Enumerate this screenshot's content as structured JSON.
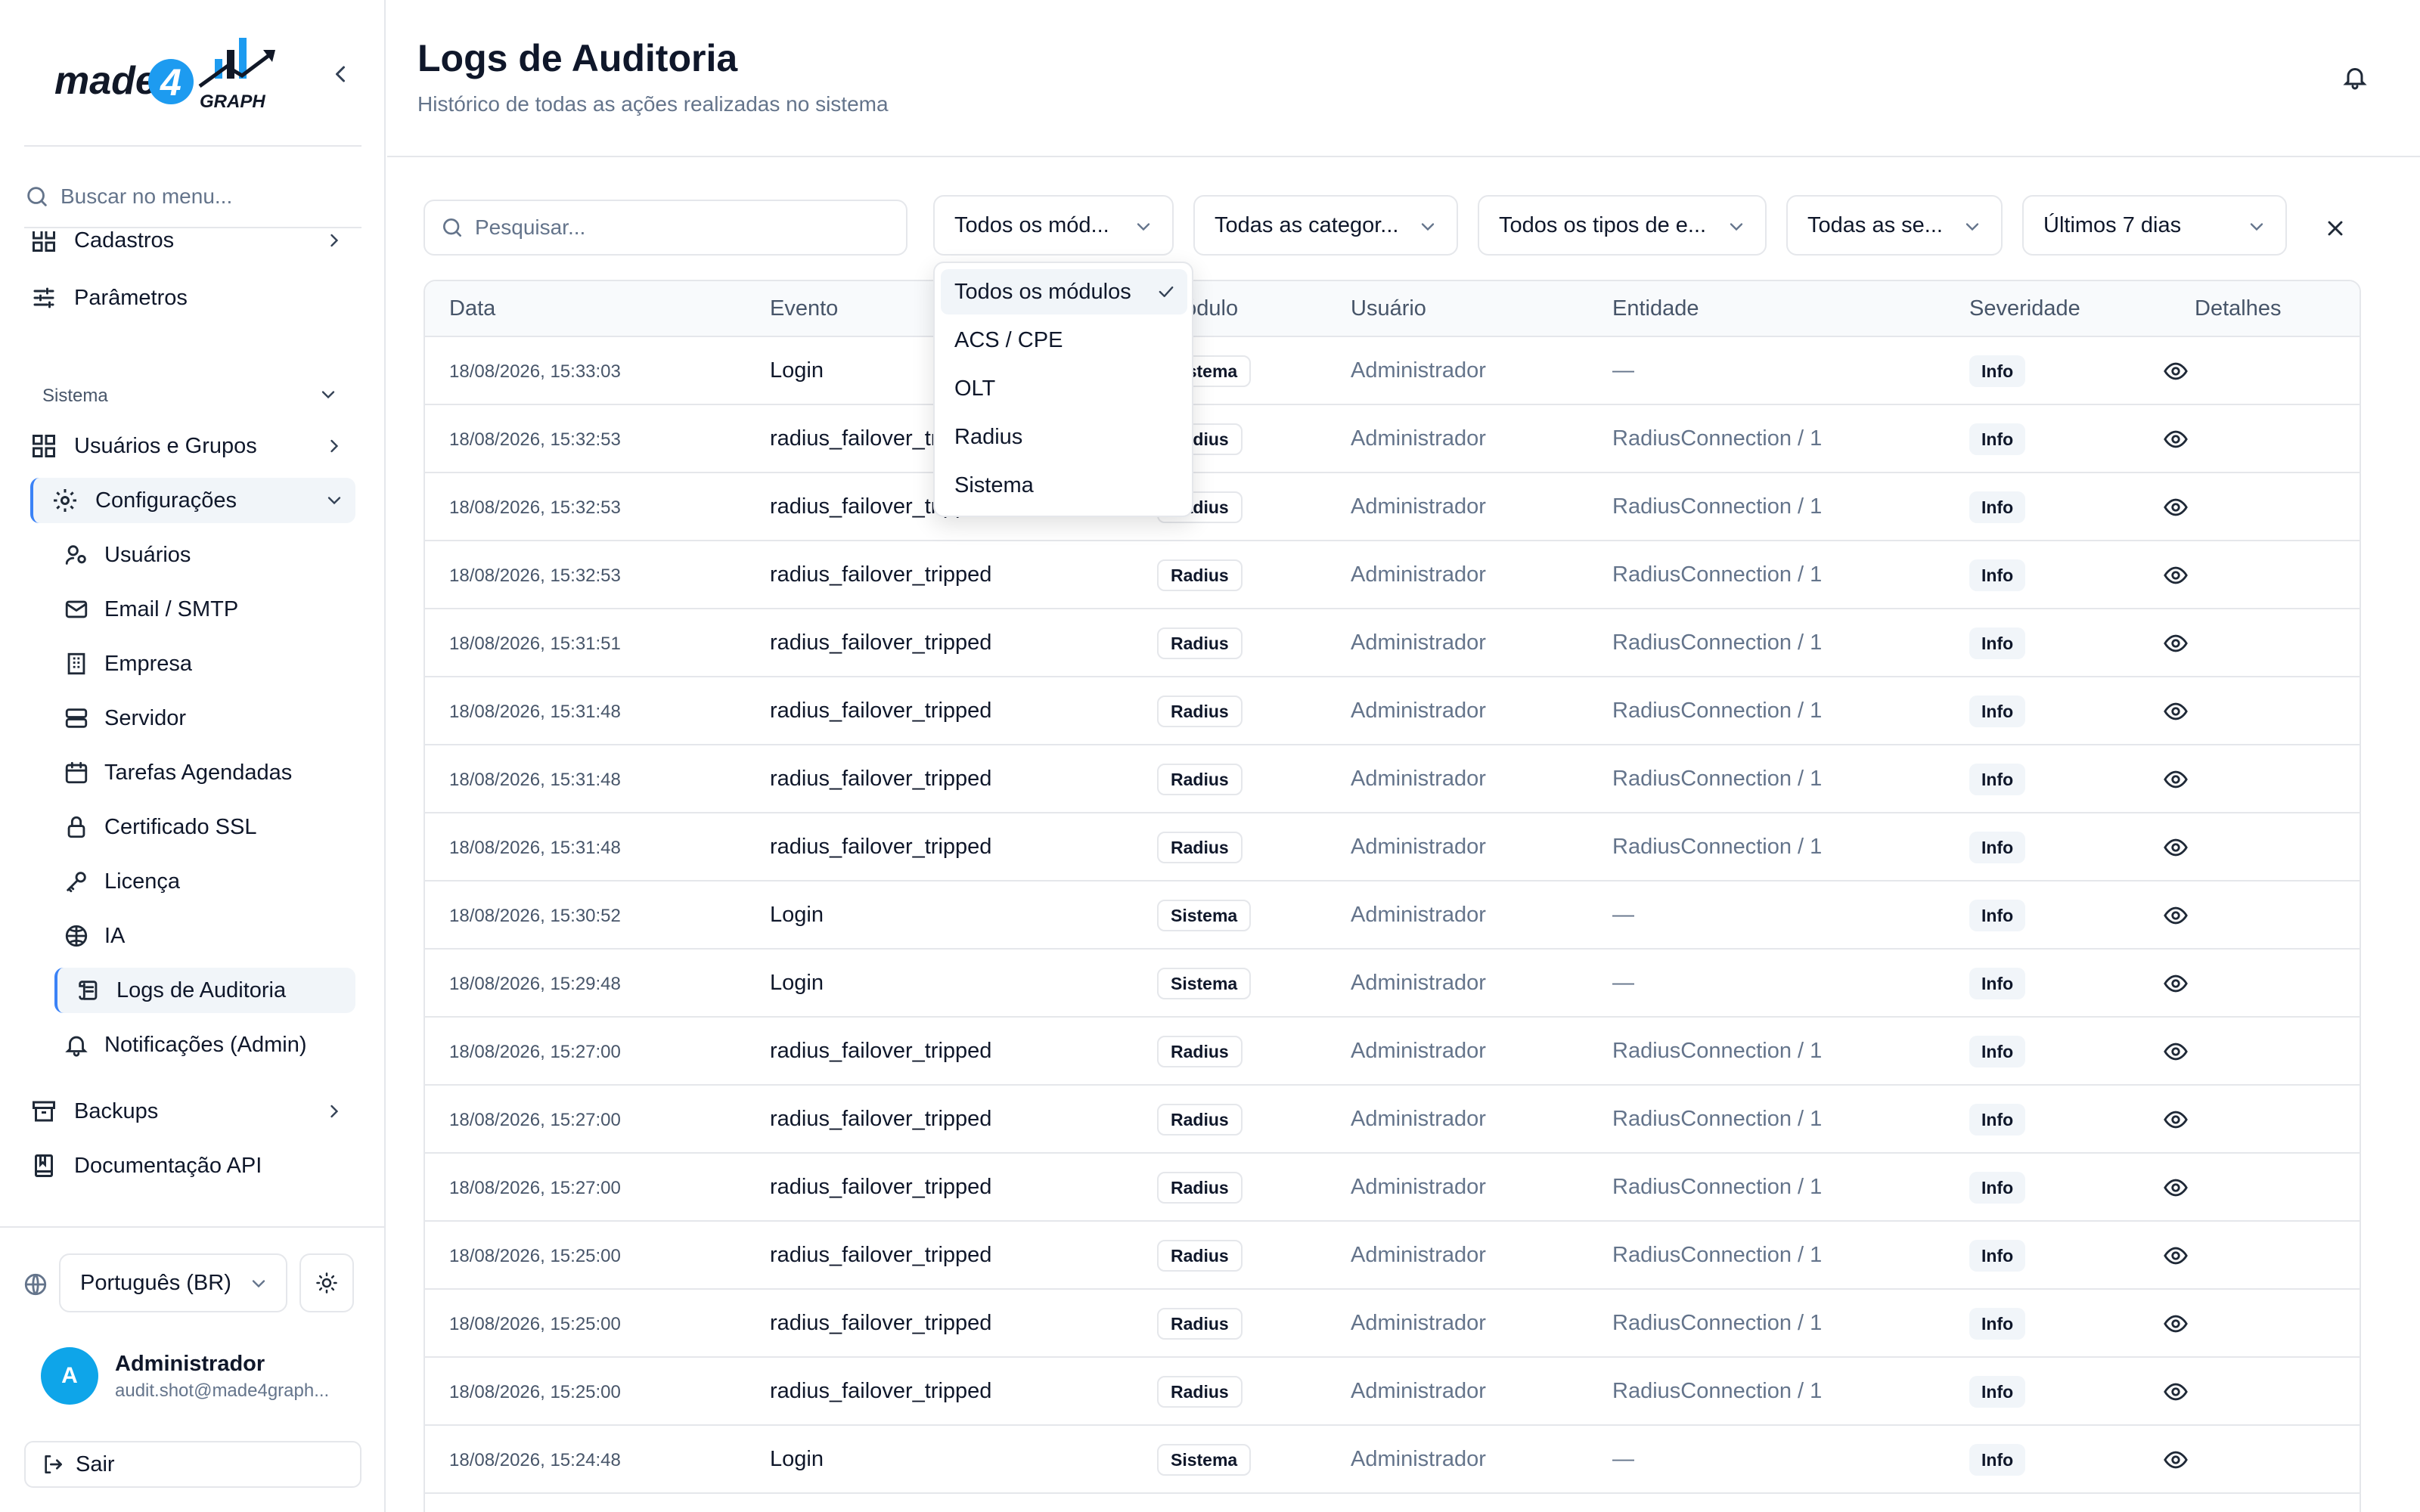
{
  "brand": {
    "logo_alt": "made4graph"
  },
  "sidebar": {
    "search_placeholder": "Buscar no menu...",
    "top_items": [
      {
        "label": "Cadastros",
        "icon": "grid-icon",
        "has_chevron": true
      },
      {
        "label": "Parâmetros",
        "icon": "sliders-icon",
        "has_chevron": false
      }
    ],
    "section_label": "Sistema",
    "section_items": [
      {
        "label": "Usuários e Grupos",
        "icon": "grid-icon",
        "has_chevron": true
      },
      {
        "label": "Configurações",
        "icon": "gear-icon",
        "expanded": true
      }
    ],
    "config_children": [
      {
        "label": "Usuários",
        "icon": "users-icon"
      },
      {
        "label": "Email / SMTP",
        "icon": "mail-icon"
      },
      {
        "label": "Empresa",
        "icon": "building-icon"
      },
      {
        "label": "Servidor",
        "icon": "server-icon"
      },
      {
        "label": "Tarefas Agendadas",
        "icon": "calendar-icon"
      },
      {
        "label": "Certificado SSL",
        "icon": "lock-icon"
      },
      {
        "label": "Licença",
        "icon": "key-icon"
      },
      {
        "label": "IA",
        "icon": "brain-icon"
      },
      {
        "label": "Logs de Auditoria",
        "icon": "scroll-icon",
        "active": true
      },
      {
        "label": "Notificações (Admin)",
        "icon": "bell-icon"
      }
    ],
    "bottom_items": [
      {
        "label": "Backups",
        "icon": "archive-icon",
        "has_chevron": true
      },
      {
        "label": "Documentação API",
        "icon": "book-icon",
        "has_chevron": false
      }
    ],
    "language": "Português (BR)",
    "user": {
      "initial": "A",
      "name": "Administrador",
      "email": "audit.shot@made4graph..."
    },
    "logout_label": "Sair"
  },
  "header": {
    "title": "Logs de Auditoria",
    "subtitle": "Histórico de todas as ações realizadas no sistema"
  },
  "filters": {
    "search_placeholder": "Pesquisar...",
    "module": "Todos os mód...",
    "category": "Todas as categor...",
    "event_type": "Todos os tipos de e...",
    "severity": "Todas as se...",
    "period": "Últimos 7 dias"
  },
  "module_dropdown": {
    "options": [
      "Todos os módulos",
      "ACS / CPE",
      "OLT",
      "Radius",
      "Sistema"
    ],
    "selected": "Todos os módulos"
  },
  "table": {
    "columns": [
      "Data",
      "Evento",
      "Módulo",
      "Usuário",
      "Entidade",
      "Severidade",
      "Detalhes"
    ],
    "rows": [
      {
        "date": "18/08/2026, 15:33:03",
        "event": "Login",
        "module": "Sistema",
        "user": "Administrador",
        "entity": "—",
        "severity": "Info"
      },
      {
        "date": "18/08/2026, 15:32:53",
        "event": "radius_failover_tripped",
        "module": "Radius",
        "user": "Administrador",
        "entity": "RadiusConnection / 1",
        "severity": "Info"
      },
      {
        "date": "18/08/2026, 15:32:53",
        "event": "radius_failover_tripped",
        "module": "Radius",
        "user": "Administrador",
        "entity": "RadiusConnection / 1",
        "severity": "Info"
      },
      {
        "date": "18/08/2026, 15:32:53",
        "event": "radius_failover_tripped",
        "module": "Radius",
        "user": "Administrador",
        "entity": "RadiusConnection / 1",
        "severity": "Info"
      },
      {
        "date": "18/08/2026, 15:31:51",
        "event": "radius_failover_tripped",
        "module": "Radius",
        "user": "Administrador",
        "entity": "RadiusConnection / 1",
        "severity": "Info"
      },
      {
        "date": "18/08/2026, 15:31:48",
        "event": "radius_failover_tripped",
        "module": "Radius",
        "user": "Administrador",
        "entity": "RadiusConnection / 1",
        "severity": "Info"
      },
      {
        "date": "18/08/2026, 15:31:48",
        "event": "radius_failover_tripped",
        "module": "Radius",
        "user": "Administrador",
        "entity": "RadiusConnection / 1",
        "severity": "Info"
      },
      {
        "date": "18/08/2026, 15:31:48",
        "event": "radius_failover_tripped",
        "module": "Radius",
        "user": "Administrador",
        "entity": "RadiusConnection / 1",
        "severity": "Info"
      },
      {
        "date": "18/08/2026, 15:30:52",
        "event": "Login",
        "module": "Sistema",
        "user": "Administrador",
        "entity": "—",
        "severity": "Info"
      },
      {
        "date": "18/08/2026, 15:29:48",
        "event": "Login",
        "module": "Sistema",
        "user": "Administrador",
        "entity": "—",
        "severity": "Info"
      },
      {
        "date": "18/08/2026, 15:27:00",
        "event": "radius_failover_tripped",
        "module": "Radius",
        "user": "Administrador",
        "entity": "RadiusConnection / 1",
        "severity": "Info"
      },
      {
        "date": "18/08/2026, 15:27:00",
        "event": "radius_failover_tripped",
        "module": "Radius",
        "user": "Administrador",
        "entity": "RadiusConnection / 1",
        "severity": "Info"
      },
      {
        "date": "18/08/2026, 15:27:00",
        "event": "radius_failover_tripped",
        "module": "Radius",
        "user": "Administrador",
        "entity": "RadiusConnection / 1",
        "severity": "Info"
      },
      {
        "date": "18/08/2026, 15:25:00",
        "event": "radius_failover_tripped",
        "module": "Radius",
        "user": "Administrador",
        "entity": "RadiusConnection / 1",
        "severity": "Info"
      },
      {
        "date": "18/08/2026, 15:25:00",
        "event": "radius_failover_tripped",
        "module": "Radius",
        "user": "Administrador",
        "entity": "RadiusConnection / 1",
        "severity": "Info"
      },
      {
        "date": "18/08/2026, 15:25:00",
        "event": "radius_failover_tripped",
        "module": "Radius",
        "user": "Administrador",
        "entity": "RadiusConnection / 1",
        "severity": "Info"
      },
      {
        "date": "18/08/2026, 15:24:48",
        "event": "Login",
        "module": "Sistema",
        "user": "Administrador",
        "entity": "—",
        "severity": "Info"
      }
    ]
  },
  "colors": {
    "accent": "#3b82f6",
    "avatar": "#0ea5e9",
    "border": "#e5e7eb",
    "muted_text": "#64748b"
  }
}
